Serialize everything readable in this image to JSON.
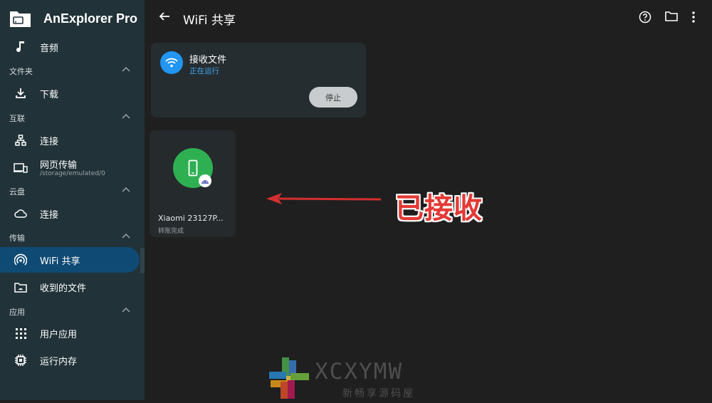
{
  "app": {
    "name": "AnExplorer Pro"
  },
  "sidebar": {
    "items_top": [
      {
        "label": "音频",
        "icon": "music-note-icon"
      }
    ],
    "sections": [
      {
        "title": "文件夹",
        "items": [
          {
            "label": "下载",
            "icon": "download-icon"
          }
        ]
      },
      {
        "title": "互联",
        "items": [
          {
            "label": "连接",
            "icon": "network-icon"
          },
          {
            "label": "网页传输",
            "sub": "/storage/emulated/0",
            "icon": "devices-icon"
          }
        ]
      },
      {
        "title": "云盘",
        "items": [
          {
            "label": "连接",
            "icon": "cloud-icon"
          }
        ]
      },
      {
        "title": "传输",
        "items": [
          {
            "label": "WiFi 共享",
            "icon": "wifi-tethering-icon",
            "active": true
          },
          {
            "label": "收到的文件",
            "icon": "received-folder-icon"
          }
        ]
      },
      {
        "title": "应用",
        "items": [
          {
            "label": "用户应用",
            "icon": "apps-grid-icon"
          },
          {
            "label": "运行内存",
            "icon": "memory-chip-icon"
          }
        ]
      }
    ]
  },
  "header": {
    "title": "WiFi 共享",
    "actions": [
      "help-icon",
      "folder-icon",
      "more-vert-icon"
    ]
  },
  "receive_card": {
    "title": "接收文件",
    "status": "正在运行",
    "stop_label": "停止",
    "icon": "wifi-icon"
  },
  "device": {
    "name": "Xiaomi 23127P...",
    "status": "转账完成",
    "icon": "phone-icon",
    "badge_icon": "android-icon"
  },
  "annotation": {
    "text": "已接收",
    "color": "#e53935"
  },
  "watermark": {
    "text": "XCXYMW",
    "subtitle": "新畅享源码屋"
  },
  "colors": {
    "sidebar_bg": "#213238",
    "active_bg": "#0f4a74",
    "accent": "#2196f3",
    "device_green": "#2eb052",
    "background": "#1f1f1f"
  }
}
